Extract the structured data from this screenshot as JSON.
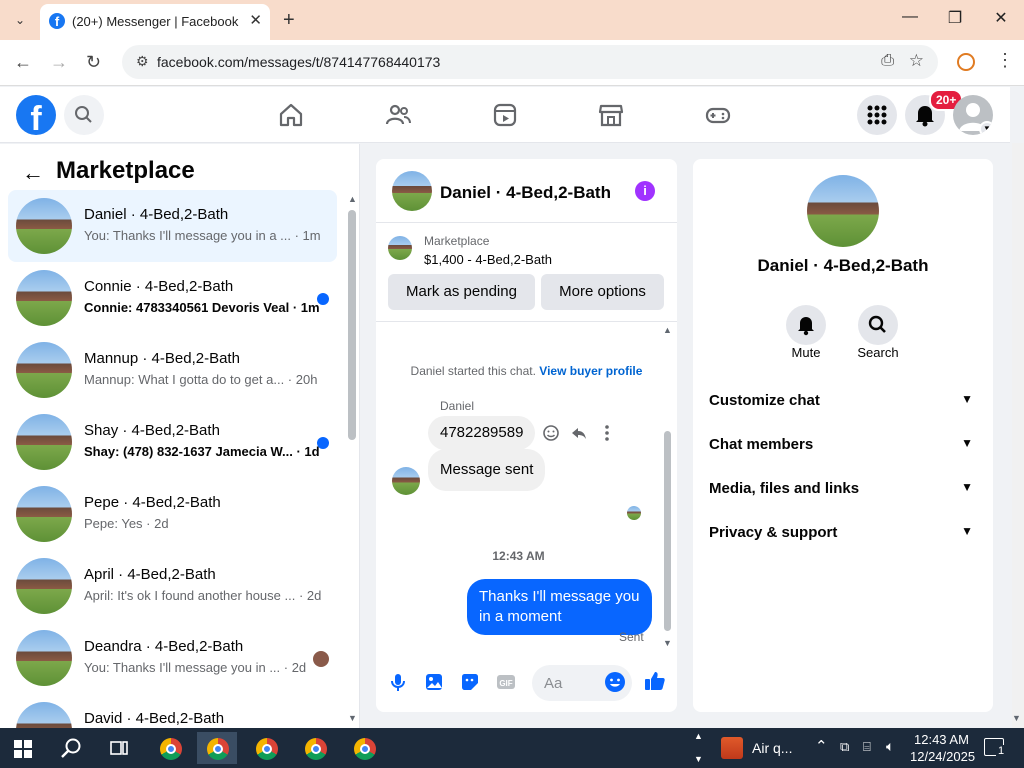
{
  "browser": {
    "tab_title": "(20+) Messenger | Facebook",
    "url": "facebook.com/messages/t/874147768440173"
  },
  "nav": {
    "notif_badge": "20+"
  },
  "left": {
    "title": "Marketplace",
    "conversations": [
      {
        "name": "Daniel · 4-Bed,2-Bath",
        "preview": "You: Thanks I'll message you in a ... · 1m",
        "unread": false,
        "selected": true
      },
      {
        "name": "Connie · 4-Bed,2-Bath",
        "preview": "Connie: 4783340561 Devoris Veal · 1m",
        "unread": true,
        "selected": false
      },
      {
        "name": "Mannup · 4-Bed,2-Bath",
        "preview": "Mannup: What I gotta do to get a... · 20h",
        "unread": false,
        "selected": false
      },
      {
        "name": "Shay · 4-Bed,2-Bath",
        "preview": "Shay: (478) 832-1637 Jamecia W... · 1d",
        "unread": true,
        "selected": false
      },
      {
        "name": "Pepe · 4-Bed,2-Bath",
        "preview": "Pepe: Yes · 2d",
        "unread": false,
        "selected": false
      },
      {
        "name": "April · 4-Bed,2-Bath",
        "preview": "April: It's ok I found another house ... · 2d",
        "unread": false,
        "selected": false
      },
      {
        "name": "Deandra · 4-Bed,2-Bath",
        "preview": "You: Thanks I'll message you in ... · 2d",
        "unread": false,
        "selected": false
      },
      {
        "name": "David · 4-Bed,2-Bath",
        "preview": "",
        "unread": false,
        "selected": false
      }
    ]
  },
  "chat": {
    "title": "Daniel · 4-Bed,2-Bath",
    "listing_label": "Marketplace",
    "listing_price": "$1,400 - 4-Bed,2-Bath",
    "mark_pending": "Mark as pending",
    "more_options": "More options",
    "system_text": "Daniel started this chat.",
    "view_buyer": "View buyer profile",
    "sender": "Daniel",
    "msg1": "4782289589",
    "msg2": "Message sent",
    "time": "12:43 AM",
    "out_msg": "Thanks I'll message you in a moment",
    "status": "Sent",
    "composer_placeholder": "Aa"
  },
  "right": {
    "name": "Daniel · 4-Bed,2-Bath",
    "mute": "Mute",
    "search": "Search",
    "rows": [
      "Customize chat",
      "Chat members",
      "Media, files and links",
      "Privacy & support"
    ]
  },
  "taskbar": {
    "weather": "Air q...",
    "time": "12:43 AM",
    "date": "12/24/2025",
    "notif_count": "1"
  }
}
